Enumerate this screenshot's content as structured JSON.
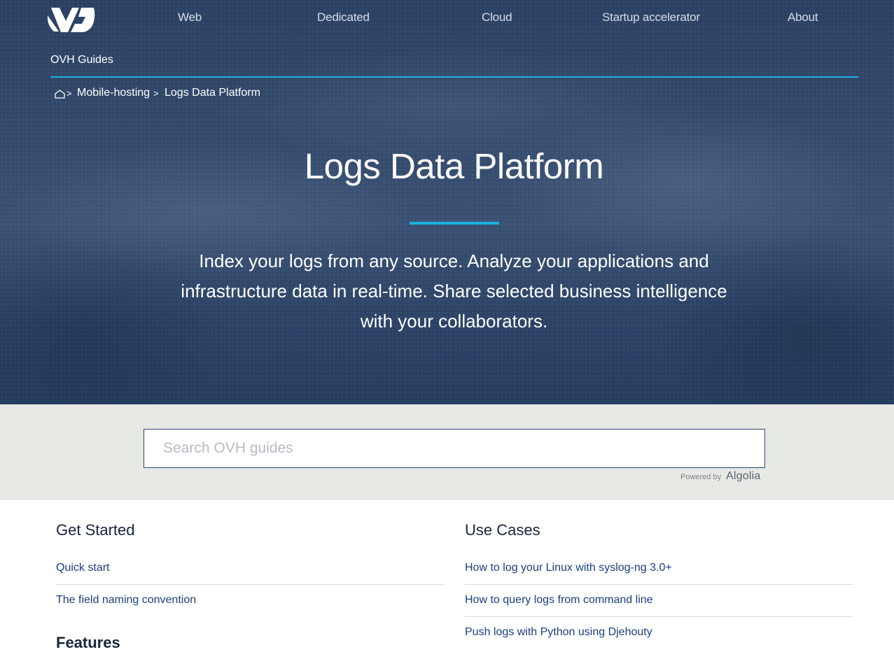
{
  "header": {
    "logo": "OVH logo",
    "nav": [
      "Web",
      "Dedicated",
      "Cloud",
      "Startup accelerator",
      "About"
    ]
  },
  "guides": {
    "title": "OVH Guides"
  },
  "breadcrumb": {
    "home_icon": "home-icon",
    "separator": ">",
    "items": [
      "Mobile-hosting",
      "Logs Data Platform"
    ]
  },
  "hero": {
    "title": "Logs Data Platform",
    "intro": "Index your logs from any source. Analyze your applications and infrastructure data in real-time. Share selected business intelligence with your collaborators."
  },
  "search": {
    "placeholder": "Search OVH guides",
    "value": "",
    "powered_by": "Powered by",
    "provider": "Algolia"
  },
  "sections": {
    "get_started": {
      "title": "Get Started",
      "links": [
        "Quick start",
        "The field naming convention"
      ]
    },
    "use_cases": {
      "title": "Use Cases",
      "links": [
        "How to log your Linux with syslog-ng 3.0+",
        "How to query logs from command line",
        "Push logs with Python using Djehouty"
      ]
    },
    "next_title": "Features"
  },
  "colors": {
    "hero_background": "#2a4163",
    "accent": "#1ab0dc",
    "search_band": "#e7e9e4",
    "link": "#1a3f80"
  }
}
